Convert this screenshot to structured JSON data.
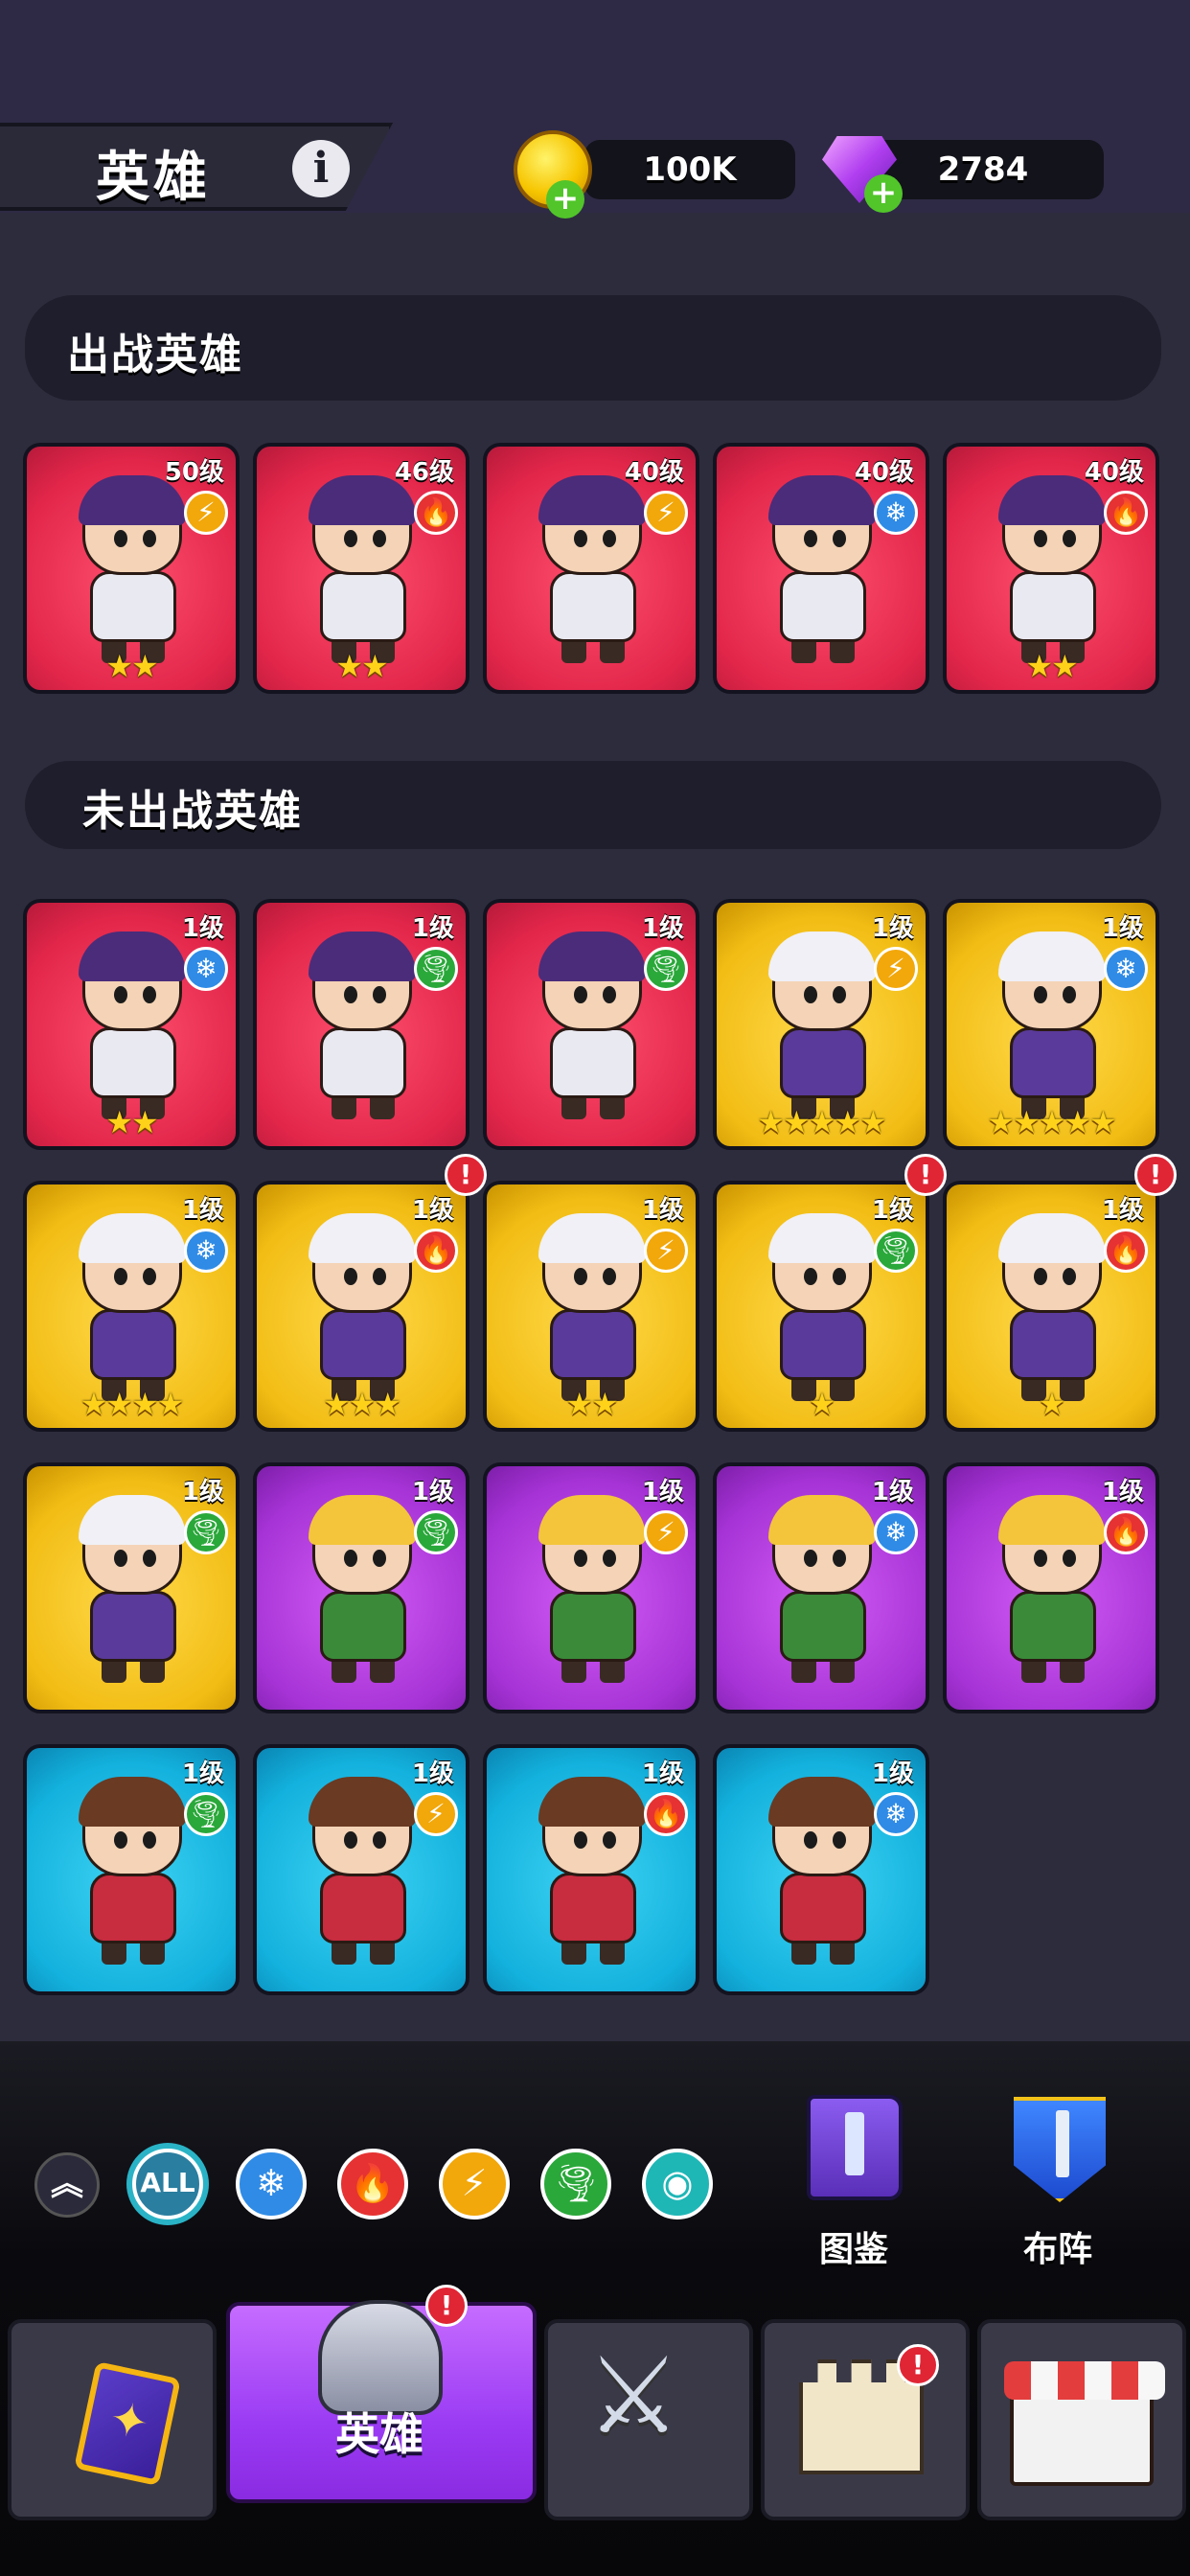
{
  "header": {
    "title": "英雄",
    "info_glyph": "i",
    "coins": "100K",
    "gems": "2784",
    "add_glyph": "+"
  },
  "sections": {
    "deployed": "出战英雄",
    "undeployed": "未出战英雄"
  },
  "deployed_heroes": [
    {
      "level": "50级",
      "element": "lightning",
      "stars": "★★",
      "color": "red"
    },
    {
      "level": "46级",
      "element": "fire",
      "stars": "★★",
      "color": "red"
    },
    {
      "level": "40级",
      "element": "lightning",
      "stars": "",
      "color": "red"
    },
    {
      "level": "40级",
      "element": "ice",
      "stars": "",
      "color": "red"
    },
    {
      "level": "40级",
      "element": "fire",
      "stars": "★★",
      "color": "red"
    }
  ],
  "undeployed_heroes": [
    {
      "level": "1级",
      "element": "ice",
      "stars": "★★",
      "color": "red",
      "alert": false
    },
    {
      "level": "1级",
      "element": "wind",
      "stars": "",
      "color": "red",
      "alert": false
    },
    {
      "level": "1级",
      "element": "wind",
      "stars": "",
      "color": "red",
      "alert": false
    },
    {
      "level": "1级",
      "element": "lightning",
      "stars": "★★★★★",
      "color": "gold",
      "alert": false
    },
    {
      "level": "1级",
      "element": "ice",
      "stars": "★★★★★",
      "color": "gold",
      "alert": false
    },
    {
      "level": "1级",
      "element": "ice",
      "stars": "★★★★",
      "color": "gold",
      "alert": false
    },
    {
      "level": "1级",
      "element": "fire",
      "stars": "★★★",
      "color": "gold",
      "alert": true
    },
    {
      "level": "1级",
      "element": "lightning",
      "stars": "★★",
      "color": "gold",
      "alert": false
    },
    {
      "level": "1级",
      "element": "wind",
      "stars": "★",
      "color": "gold",
      "alert": true
    },
    {
      "level": "1级",
      "element": "fire",
      "stars": "★",
      "color": "gold",
      "alert": true
    },
    {
      "level": "1级",
      "element": "wind",
      "stars": "",
      "color": "gold",
      "alert": false
    },
    {
      "level": "1级",
      "element": "wind",
      "stars": "",
      "color": "purple",
      "alert": false
    },
    {
      "level": "1级",
      "element": "lightning",
      "stars": "",
      "color": "purple",
      "alert": false
    },
    {
      "level": "1级",
      "element": "ice",
      "stars": "",
      "color": "purple",
      "alert": false
    },
    {
      "level": "1级",
      "element": "fire",
      "stars": "",
      "color": "purple",
      "alert": false
    },
    {
      "level": "1级",
      "element": "wind",
      "stars": "",
      "color": "cyan",
      "alert": false
    },
    {
      "level": "1级",
      "element": "lightning",
      "stars": "",
      "color": "cyan",
      "alert": false
    },
    {
      "level": "1级",
      "element": "fire",
      "stars": "",
      "color": "cyan",
      "alert": false
    },
    {
      "level": "1级",
      "element": "ice",
      "stars": "",
      "color": "cyan",
      "alert": false
    }
  ],
  "filters": {
    "collapse_glyph": "︽",
    "all_label": "ALL",
    "ice_glyph": "❄",
    "fire_glyph": "🔥",
    "lightning_glyph": "⚡",
    "wind_glyph": "🌪",
    "eye_glyph": "◉"
  },
  "actions": {
    "codex_label": "图鉴",
    "formation_label": "布阵"
  },
  "nav": {
    "hero_label": "英雄",
    "alert_glyph": "!",
    "swords_glyph": "⚔"
  },
  "element_glyphs": {
    "ice": "❄",
    "fire": "🔥",
    "lightning": "⚡",
    "wind": "🌪"
  },
  "colors": {
    "ice": "#2f8be6",
    "fire": "#e63232",
    "lightning": "#f2a70a",
    "wind": "#2aa83a",
    "all_filter": "#2a7ea0",
    "eye_filter": "#1fb6b6"
  }
}
